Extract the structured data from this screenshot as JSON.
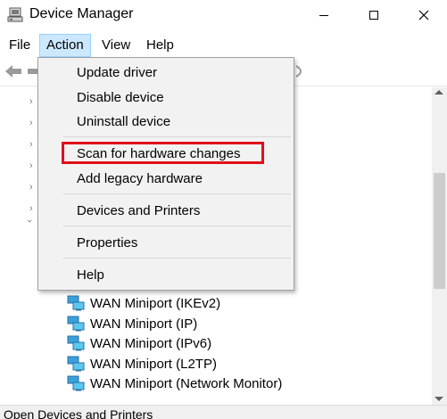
{
  "window": {
    "title": "Device Manager",
    "icon": "device-manager-icon"
  },
  "menubar": {
    "items": [
      {
        "label": "File"
      },
      {
        "label": "Action"
      },
      {
        "label": "View"
      },
      {
        "label": "Help"
      }
    ]
  },
  "action_menu": {
    "items": [
      {
        "label": "Update driver"
      },
      {
        "label": "Disable device"
      },
      {
        "label": "Uninstall device"
      },
      {
        "label": "Scan for hardware changes",
        "highlighted": true
      },
      {
        "label": "Add legacy hardware"
      },
      {
        "label": "Devices and Printers"
      },
      {
        "label": "Properties"
      },
      {
        "label": "Help"
      }
    ]
  },
  "tree": {
    "items": [
      {
        "label": "WAN Miniport (IKEv2)"
      },
      {
        "label": "WAN Miniport (IP)"
      },
      {
        "label": "WAN Miniport (IPv6)"
      },
      {
        "label": "WAN Miniport (L2TP)"
      },
      {
        "label": "WAN Miniport (Network Monitor)"
      }
    ]
  },
  "statusbar": {
    "text": "Open Devices and Printers"
  },
  "colors": {
    "menu_highlight": "#cce8ff",
    "highlight_box": "#e0101a",
    "dropdown_bg": "#f2f2f2"
  }
}
